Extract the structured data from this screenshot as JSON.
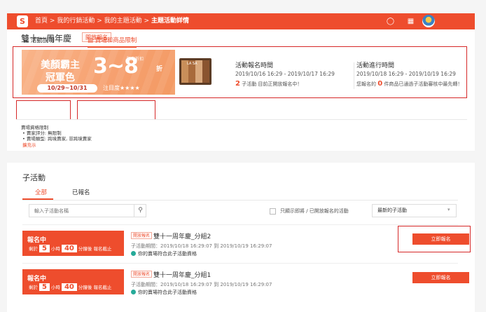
{
  "topbar": {
    "logo": "S",
    "breadcrumb": [
      "首頁",
      "我的行銷活動",
      "我的主題活動"
    ],
    "separator": ">",
    "current": "主題活動詳情"
  },
  "campaign": {
    "title": "雙十一周年慶",
    "status": "開放報名"
  },
  "banner": {
    "line1": "美顏霸主",
    "line2": "冠軍色",
    "big": "3~8",
    "suffix": "折",
    "badge": "限定折扣",
    "date_range": "10/29~10/31",
    "notice": "注目度★★★★",
    "product_label": "LA SA"
  },
  "registration": {
    "title": "活動報名時間",
    "range": "2019/10/16 16:29 - 2019/10/17 16:29",
    "count": "2",
    "note": "子活動 目前正開放報名中！"
  },
  "running": {
    "title": "活動進行時間",
    "range": "2019/10/18 16:29 - 2019/10/19 16:29",
    "prefix": "您報名的",
    "count": "0",
    "note": "件商品已通過子活動審核中最先轉！"
  },
  "tabs": [
    "活動說明",
    "賣場和商品限制"
  ],
  "requirements": {
    "title": "賣場資格限制",
    "items": [
      "• 賣家評分: 無限制",
      "• 賣場類型: 跨境賣家, 非跨境賣家"
    ],
    "expand": "擴充示"
  },
  "sub": {
    "title": "子活動",
    "tabs": [
      "全部",
      "已報名"
    ],
    "search_placeholder": "輸入子活動名稱",
    "filter_label": "只顯示即將 / 已開放報名的活動",
    "sort_value": "最新的子活動",
    "sort_caret": "▾",
    "items": [
      {
        "status": "報名中",
        "remain_prefix": "剩於",
        "hours": "5",
        "hours_unit": "小時",
        "minutes": "40",
        "minutes_suffix": "分鐘後 報名截止",
        "tag": "開放報名",
        "name": "雙十一周年慶_分組2",
        "period": "子活動期間：2019/10/18 16:29:07 到 2019/10/19 16:29:07",
        "qualify": "你的賣場符合此子活動資格",
        "button": "立即報名"
      },
      {
        "status": "報名中",
        "remain_prefix": "剩於",
        "hours": "5",
        "hours_unit": "小時",
        "minutes": "40",
        "minutes_suffix": "分鐘後 報名截止",
        "tag": "開放報名",
        "name": "雙十一周年慶_分組1",
        "period": "子活動期間：2019/10/18 16:29:07 到 2019/10/19 16:29:07",
        "qualify": "你的賣場符合此子活動資格",
        "button": "立即報名"
      }
    ]
  },
  "colors": {
    "accent": "#ee4d2d",
    "highlight": "#d62828",
    "success": "#26aa99"
  },
  "icons": [
    "shopee-logo-icon",
    "bell-icon",
    "grid-icon",
    "document-icon",
    "search-icon",
    "success-dot-icon"
  ]
}
